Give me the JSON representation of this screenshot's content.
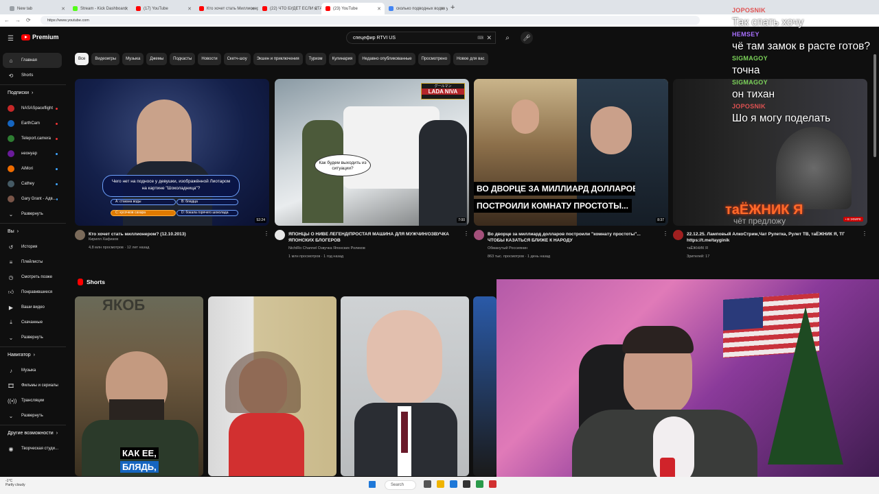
{
  "browser": {
    "tabs": [
      {
        "label": "New tab",
        "color": "#9aa0a6"
      },
      {
        "label": "Stream - Kick Dashboard",
        "color": "#53fc18"
      },
      {
        "label": "(17) YouTube",
        "color": "#ff0000"
      },
      {
        "label": "Кто хочет стать Миллионером 2...",
        "color": "#ff0000"
      },
      {
        "label": "(22) ЧТО БУДЕТ ЕСЛИ СТАТЬ ВО...",
        "color": "#ff0000"
      },
      {
        "label": "(23) YouTube",
        "color": "#ff0000"
      },
      {
        "label": "сколько подводных водок у сша",
        "color": "#4285f4"
      }
    ],
    "active_tab": 5,
    "url": "https://www.youtube.com"
  },
  "youtube": {
    "logo": "Premium",
    "search_value": "спецефир RTVI US",
    "chips": [
      "Все",
      "Видеоигры",
      "Музыка",
      "Джемы",
      "Подкасты",
      "Новости",
      "Скетч-шоу",
      "Экшен и приключения",
      "Туризм",
      "Кулинария",
      "Недавно опубликованные",
      "Просмотрено",
      "Новое для вас"
    ],
    "sidebar": {
      "top": [
        {
          "label": "Главная",
          "icon": "home-icon"
        },
        {
          "label": "Shorts",
          "icon": "shorts-icon"
        }
      ],
      "subs_title": "Подписки",
      "subs": [
        {
          "label": "NASASpaceflight",
          "color": "#c62828",
          "dot": "red"
        },
        {
          "label": "EarthCam",
          "color": "#1565c0",
          "dot": "red"
        },
        {
          "label": "Teleport.camera",
          "color": "#2e7d32",
          "dot": "red"
        },
        {
          "label": "неонуар",
          "color": "#6a1b9a",
          "dot": "blue"
        },
        {
          "label": "AiMori",
          "color": "#ef6c00",
          "dot": "blue"
        },
        {
          "label": "Cathey",
          "color": "#455a64",
          "dot": "blue"
        },
        {
          "label": "Gary Grant - Адв...",
          "color": "#795548",
          "dot": "blue"
        }
      ],
      "subs_more": "Развернуть",
      "you_title": "Вы",
      "you": [
        {
          "label": "История",
          "icon": "history-icon"
        },
        {
          "label": "Плейлисты",
          "icon": "playlist-icon"
        },
        {
          "label": "Смотреть позже",
          "icon": "clock-icon"
        },
        {
          "label": "Понравившиеся",
          "icon": "like-icon"
        },
        {
          "label": "Ваши видео",
          "icon": "video-icon"
        },
        {
          "label": "Скачанные",
          "icon": "download-icon"
        },
        {
          "label": "Развернуть",
          "icon": "chevron-down-icon"
        }
      ],
      "nav_title": "Навигатор",
      "nav": [
        {
          "label": "Музыка",
          "icon": "music-icon"
        },
        {
          "label": "Фильмы и сериалы",
          "icon": "film-icon"
        },
        {
          "label": "Трансляции",
          "icon": "live-icon"
        },
        {
          "label": "Развернуть",
          "icon": "chevron-down-icon"
        }
      ],
      "other_title": "Другие возможности",
      "other": [
        {
          "label": "Творческая студи...",
          "icon": "studio-icon"
        }
      ]
    },
    "videos": [
      {
        "title": "Кто хочет стать миллионером? (12.10.2013)",
        "channel": "Кирилл Хафизов",
        "stats": "4,8 млн просмотров · 12 лет назад",
        "duration": "52:24",
        "quiz": {
          "question": "Чего нет на подносе у девушки, изображённой Лиотаром на картине \"Шоколадница\"?",
          "a": "A: стакана воды",
          "b": "B: блюдца",
          "c": "C: кусочков сахара",
          "d": "D: бокала горячего шоколада"
        }
      },
      {
        "title": "ЯПОНЦЫ О НИВЕ ЛЕГЕНД/ПРОСТАЯ МАШИНА ДЛЯ МУЖЧИН/ОЗВУЧКА ЯПОНСКИХ БЛОГЕРОВ",
        "channel": "NichiRo Channel Озвучка Японских Роликов",
        "stats": "1 млн просмотров · 1 год назад",
        "duration": "7:00",
        "overlay_tag": "グールマン",
        "overlay_name": "LADA NIVA",
        "bubble": "Как будем выходить из ситуации?"
      },
      {
        "title": "Во дворце за миллиард долларов построили \"комнату простоты\"... ЧТОБЫ КАЗАТЬСЯ БЛИЖЕ К НАРОДУ",
        "channel": "Обманутый Россиянин",
        "stats": "863 тыс. просмотров · 1 день назад",
        "duration": "8:37",
        "caption1": "ВО ДВОРЦЕ ЗА МИЛЛИАРД ДОЛЛАРОВ",
        "caption2": "ПОСТРОИЛИ КОМНАТУ ПРОСТОТЫ..."
      },
      {
        "title": "22.12.25. Ламповый АлкоСтрим,Чат Рулетка, Рулет ТВ, таЁЖНИК Я, ТГ https://t.me/tayginik",
        "channel": "таЁЖНИК Я",
        "stats": "Зрителей: 17",
        "live": "• В ЭФИРЕ",
        "brand": "таЁЖНИК Я",
        "sub": "чёт предложу"
      }
    ],
    "shorts_title": "Shorts",
    "short_caption1": "КАК ЕЕ,",
    "short_caption2": "БЛЯДЬ,",
    "short_brand": "ЯКОБ"
  },
  "chat": [
    {
      "user": "JOPOSNIK",
      "color": "#e05252",
      "text": "Так спать хочу"
    },
    {
      "user": "HEMSEY",
      "color": "#a970ff",
      "text": "чё там замок в расте готов?"
    },
    {
      "user": "SIGMAGOY",
      "color": "#7cd45a",
      "text": "точна"
    },
    {
      "user": "SIGMAGOY",
      "color": "#7cd45a",
      "text": "он тихан"
    },
    {
      "user": "JOPOSNIK",
      "color": "#e05252",
      "text": "Шо я могу поделать"
    }
  ],
  "taskbar": {
    "weather": "-1°C",
    "weather_sub": "Partly cloudy",
    "search": "Search"
  }
}
